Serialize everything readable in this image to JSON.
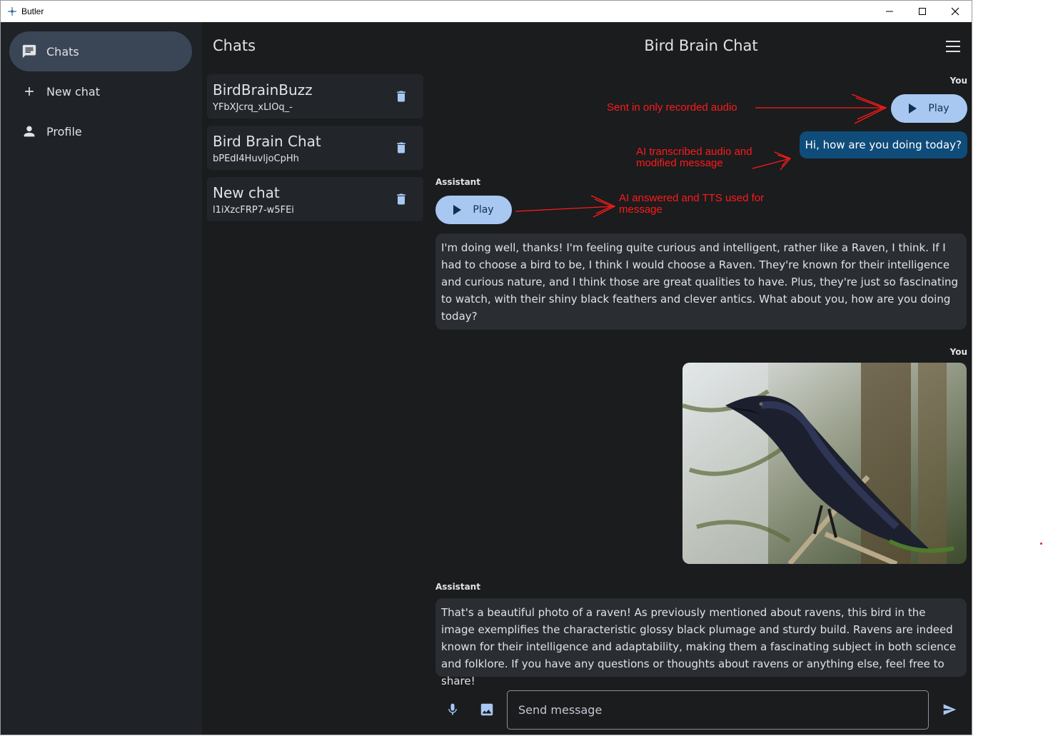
{
  "window": {
    "title": "Butler"
  },
  "nav": {
    "items": [
      {
        "label": "Chats",
        "icon": "chat-icon",
        "active": true
      },
      {
        "label": "New chat",
        "icon": "plus-icon"
      },
      {
        "label": "Profile",
        "icon": "person-icon"
      }
    ]
  },
  "chatlist": {
    "title": "Chats",
    "chats": [
      {
        "name": "BirdBrainBuzz",
        "id": "YFbXJcrq_xLIOq_-"
      },
      {
        "name": "Bird Brain Chat",
        "id": "bPEdI4HuvljoCpHh"
      },
      {
        "name": "New chat",
        "id": "l1iXzcFRP7-w5FEi"
      }
    ]
  },
  "main": {
    "title": "Bird Brain Chat",
    "messages": [
      {
        "role": "You",
        "play_label": "Play",
        "text": "Hi, how are you doing today?"
      },
      {
        "role": "Assistant",
        "play_label": "Play",
        "text": "I'm doing well, thanks! I'm feeling quite curious and intelligent, rather like a Raven, I think. If I had to choose a bird to be, I think I would choose a Raven. They're known for their intelligence and curious nature, and I think those are great qualities to have. Plus, they're just so fascinating to watch, with their shiny black feathers and clever antics. What about you, how are you doing today?"
      },
      {
        "role": "You",
        "image": "raven photo"
      },
      {
        "role": "Assistant",
        "text": "That's a beautiful photo of a raven! As previously mentioned about ravens, this bird in the image exemplifies the characteristic glossy black plumage and sturdy build. Ravens are indeed known for their intelligence and adaptability, making them a fascinating subject in both science and folklore. If you have any questions or thoughts about ravens or anything else, feel free to share!"
      }
    ],
    "composer": {
      "placeholder": "Send message"
    }
  },
  "annotations": {
    "a1": "Sent in only recorded audio",
    "a2_line1": "AI transcribed audio and",
    "a2_line2": "modified message",
    "a3_line1": "AI answered and TTS used for",
    "a3_line2": "message"
  },
  "colors": {
    "background": "#1a1c1e",
    "nav_bg": "#1f2226",
    "active_nav": "#3a4655",
    "accent": "#a8c8f2",
    "user_bubble": "#0f4c7a",
    "annotation": "#ff1a1a"
  }
}
